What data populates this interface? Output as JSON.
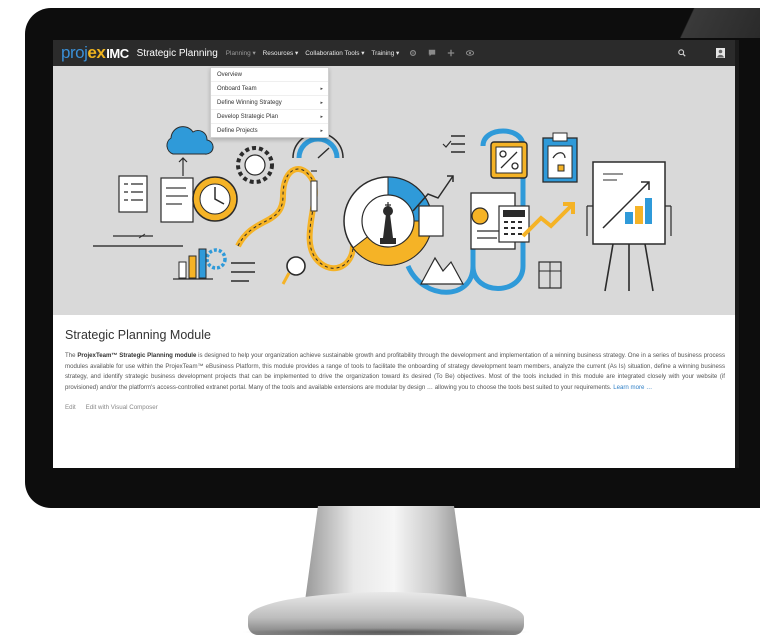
{
  "navbar": {
    "logo_part1": "proj",
    "logo_part2": "ex",
    "logo_part3": "IMC",
    "site_title": "Strategic Planning",
    "menu": [
      {
        "label": "Planning ▾"
      },
      {
        "label": "Resources ▾"
      },
      {
        "label": "Collaboration Tools ▾"
      },
      {
        "label": "Training ▾"
      }
    ],
    "icons": [
      "settings-icon",
      "comment-icon",
      "plus-icon",
      "eye-icon"
    ],
    "right_icons": [
      "search-icon",
      "user-avatar-icon"
    ]
  },
  "dropdown": {
    "items": [
      {
        "label": "Overview",
        "submenu": false
      },
      {
        "label": "Onboard Team",
        "submenu": true
      },
      {
        "label": "Define Winning Strategy",
        "submenu": true
      },
      {
        "label": "Develop Strategic Plan",
        "submenu": true
      },
      {
        "label": "Define Projects",
        "submenu": true
      }
    ],
    "submenu_caret": "▸"
  },
  "content": {
    "title": "Strategic Planning Module",
    "para_intro": "The ",
    "para_bold": "ProjexTeam™ Strategic Planning module",
    "para_body": " is designed to help your organization achieve sustainable growth and profitability through the development and implementation of a winning business strategy. One in a series of business process modules available for use within the ProjexTeam™ eBusiness Platform, this module provides a range of tools to facilitate the onboarding of strategy development team members, analyze the current (As Is) situation, define a winning business strategy, and identify strategic business development projects that can be implemented to drive the organization toward its desired (To Be) objectives. Most of the tools included in this module are integrated closely with your website (if provisioned) and/or the platform's access-controlled extranet portal. Many of the tools and available extensions are modular by design … allowing you to choose the tools best suited to your requirements. ",
    "learn_more": "Learn more …",
    "edit_label": "Edit",
    "edit_vc_label": "Edit with Visual Composer"
  },
  "colors": {
    "navbar_bg": "#2b2b2b",
    "logo_blue": "#3a8fd6",
    "logo_yellow": "#f0b41e",
    "hero_bg": "#d9d9d9",
    "accent_blue": "#2f9ad9",
    "accent_yellow": "#f5b326",
    "link": "#2f7fc6"
  }
}
